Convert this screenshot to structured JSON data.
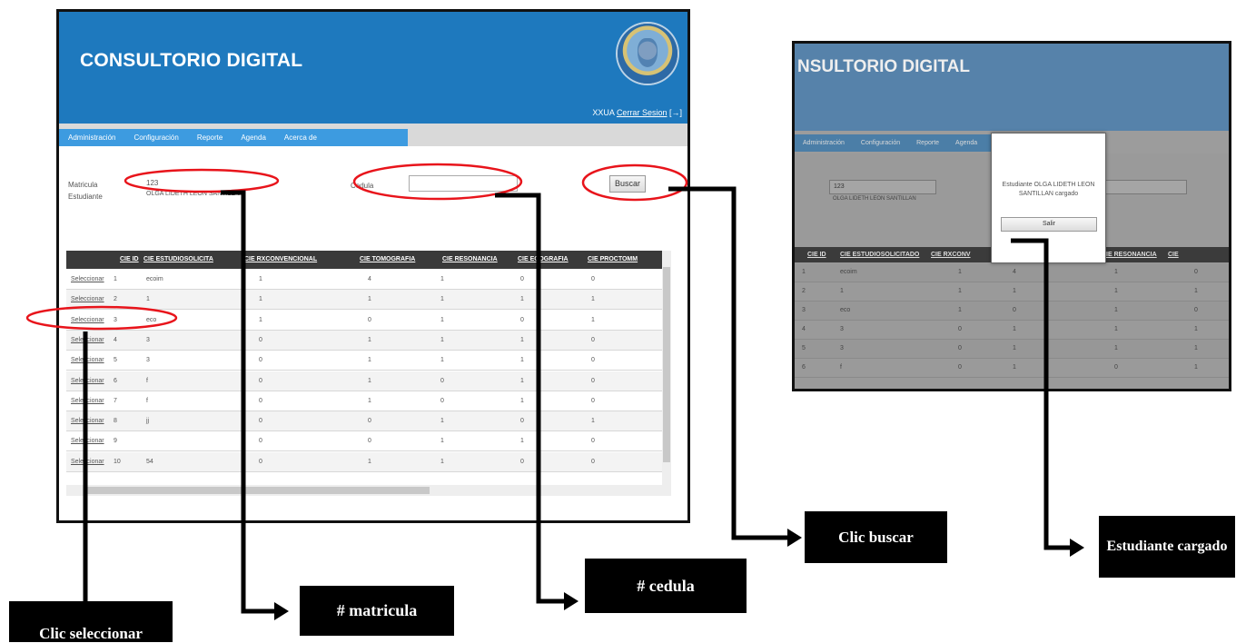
{
  "app": {
    "title": "CONSULTORIO DIGITAL",
    "title_cropped": "NSULTORIO DIGITAL",
    "user": "XXUA",
    "logout_label": "Cerrar Sesion"
  },
  "menu": [
    "Administración",
    "Configuración",
    "Reporte",
    "Agenda",
    "Acerca de"
  ],
  "form": {
    "matricula_label": "Matricula",
    "matricula_value": "123",
    "estudiante_label": "Estudiante",
    "estudiante_value": "OLGA LIDETH LEON SANTILLAN",
    "cedula_label": "Cedula",
    "cedula_value": "",
    "buscar_label": "Buscar"
  },
  "table": {
    "columns": [
      "CIE ID",
      "CIE ESTUDIOSOLICITA",
      "CIE RXCONVENCIONAL",
      "CIE TOMOGRAFIA",
      "CIE RESONANCIA",
      "CIE ECOGRAFIA",
      "CIE PROCTOMM"
    ],
    "select_label": "Seleccionar",
    "rows": [
      {
        "id": "1",
        "estudio": "ecoim",
        "rx": "1",
        "tomo": "4",
        "reso": "1",
        "eco": "0",
        "proc": "0"
      },
      {
        "id": "2",
        "estudio": "1",
        "rx": "1",
        "tomo": "1",
        "reso": "1",
        "eco": "1",
        "proc": "1"
      },
      {
        "id": "3",
        "estudio": "eco",
        "rx": "1",
        "tomo": "0",
        "reso": "1",
        "eco": "0",
        "proc": "1"
      },
      {
        "id": "4",
        "estudio": "3",
        "rx": "0",
        "tomo": "1",
        "reso": "1",
        "eco": "1",
        "proc": "0"
      },
      {
        "id": "5",
        "estudio": "3",
        "rx": "0",
        "tomo": "1",
        "reso": "1",
        "eco": "1",
        "proc": "0"
      },
      {
        "id": "6",
        "estudio": "f",
        "rx": "0",
        "tomo": "1",
        "reso": "0",
        "eco": "1",
        "proc": "0"
      },
      {
        "id": "7",
        "estudio": "f",
        "rx": "0",
        "tomo": "1",
        "reso": "0",
        "eco": "1",
        "proc": "0"
      },
      {
        "id": "8",
        "estudio": "jj",
        "rx": "0",
        "tomo": "0",
        "reso": "1",
        "eco": "0",
        "proc": "1"
      },
      {
        "id": "9",
        "estudio": "",
        "rx": "0",
        "tomo": "0",
        "reso": "1",
        "eco": "1",
        "proc": "0"
      },
      {
        "id": "10",
        "estudio": "54",
        "rx": "0",
        "tomo": "1",
        "reso": "1",
        "eco": "0",
        "proc": "0"
      }
    ]
  },
  "dialog": {
    "message": "Estudiante OLGA LIDETH LEON SANTILLAN cargado",
    "button_label": "Salir"
  },
  "right_table": {
    "columns": [
      "CIE ID",
      "CIE ESTUDIOSOLICITADO",
      "CIE RXCONV",
      "CIE RESONANCIA",
      "CIE"
    ],
    "rows": [
      {
        "id": "1",
        "estudio": "ecoim",
        "rx": "1",
        "tomo": "4",
        "reso": "1",
        "eco": "0"
      },
      {
        "id": "2",
        "estudio": "1",
        "rx": "1",
        "tomo": "1",
        "reso": "1",
        "eco": "1"
      },
      {
        "id": "3",
        "estudio": "eco",
        "rx": "1",
        "tomo": "0",
        "reso": "1",
        "eco": "0"
      },
      {
        "id": "4",
        "estudio": "3",
        "rx": "0",
        "tomo": "1",
        "reso": "1",
        "eco": "1"
      },
      {
        "id": "5",
        "estudio": "3",
        "rx": "0",
        "tomo": "1",
        "reso": "1",
        "eco": "1"
      },
      {
        "id": "6",
        "estudio": "f",
        "rx": "0",
        "tomo": "1",
        "reso": "0",
        "eco": "1"
      }
    ]
  },
  "callouts": {
    "clic_seleccionar": "Clic seleccionar",
    "matricula": "# matricula",
    "cedula": "# cedula",
    "clic_buscar": "Clic buscar",
    "estudiante_cargado": "Estudiante cargado"
  },
  "colors": {
    "header_blue": "#1e79be",
    "menu_blue": "#3d9be0",
    "highlight_red": "#e8141b",
    "callout_black": "#000000"
  }
}
